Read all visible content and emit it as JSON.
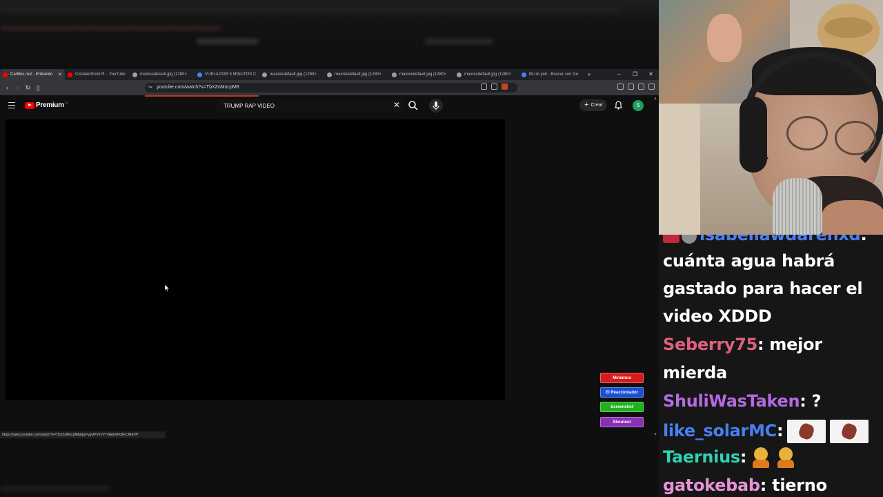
{
  "browser": {
    "tabs": [
      {
        "title": "Carlitos ruiz - Entrando",
        "active": true,
        "favicon_color": "#ff0000"
      },
      {
        "title": "CristianGhost R. - YouTube",
        "active": false,
        "favicon_color": "#ff0000"
      },
      {
        "title": "maxresdefault.jpg (1280×",
        "active": false,
        "favicon_color": "#9aa0a6"
      },
      {
        "title": "VUELA POR 5 MINUTOS C",
        "active": false,
        "favicon_color": "#4285f4"
      },
      {
        "title": "maxresdefault.jpg (1280×",
        "active": false,
        "favicon_color": "#9aa0a6"
      },
      {
        "title": "maxresdefault.jpg (1280×",
        "active": false,
        "favicon_color": "#9aa0a6"
      },
      {
        "title": "maxresdefault.jpg (1280×",
        "active": false,
        "favicon_color": "#9aa0a6"
      },
      {
        "title": "maxresdefault.jpg (1280×",
        "active": false,
        "favicon_color": "#9aa0a6"
      },
      {
        "title": "BLUe yeti - Buscar con Go",
        "active": false,
        "favicon_color": "#4285f4"
      }
    ],
    "new_tab": "+",
    "window_controls": {
      "minimize": "–",
      "restore": "❐",
      "close": "✕"
    },
    "url": "youtube.com/watch?v=TbXZoMocpM8",
    "status_url": "https://www.youtube.com/watch?v=TbXZoMocpM8&pp=ygUPVFJVTVAgUkFQIFZJREVP"
  },
  "youtube": {
    "brand": "Premium",
    "region": "CL",
    "search_query": "TRUMP RAP VIDEO",
    "create_label": "Crear",
    "avatar_letter": "S"
  },
  "stream_buttons": [
    {
      "label": "Miniatura",
      "color": "#d81a1a"
    },
    {
      "label": "El Reaccionador",
      "color": "#1a4fd8"
    },
    {
      "label": "Screenshot",
      "color": "#20b020"
    },
    {
      "label": "Shoutout",
      "color": "#8a2fb8"
    }
  ],
  "chat": {
    "lines": [
      {
        "type": "msg",
        "user": "isabellawdarenxd",
        "user_color": "#4a7ff0",
        "text": ""
      },
      {
        "type": "cont",
        "text": "cuánta agua habrá"
      },
      {
        "type": "cont",
        "text": "gastado para hacer el"
      },
      {
        "type": "cont",
        "text": "video XDDD"
      },
      {
        "type": "msg",
        "user": "Seberry75",
        "user_color": "#e0607e",
        "text": " mejor"
      },
      {
        "type": "cont",
        "text": "mierda"
      },
      {
        "type": "msg",
        "user": "ShuliWasTaken",
        "user_color": "#b36ae2",
        "text": " ?"
      },
      {
        "type": "msg",
        "user": "like_solarMC",
        "user_color": "#4a7ff0",
        "text": ""
      },
      {
        "type": "msg",
        "user": "Taernius",
        "user_color": "#2ed3b0",
        "text": ""
      },
      {
        "type": "msg",
        "user": "gatokebab",
        "user_color": "#e892d8",
        "text": " tierno"
      }
    ]
  }
}
